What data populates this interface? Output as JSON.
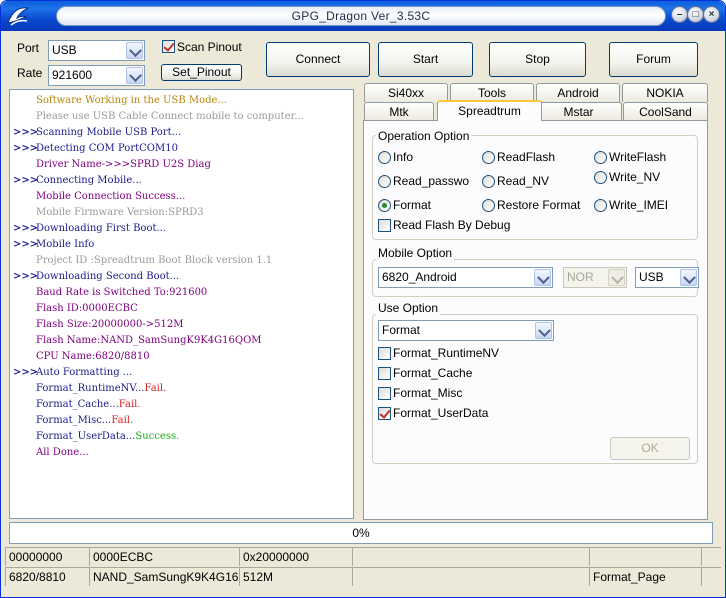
{
  "window": {
    "title": "GPG_Dragon  Ver_3.53C",
    "buttons": {
      "min": "–",
      "max": "□",
      "close": "×"
    }
  },
  "connection": {
    "port_label": "Port",
    "port_value": "USB",
    "rate_label": "Rate",
    "rate_value": "921600",
    "scan_pinout_label": "Scan Pinout",
    "scan_pinout_checked": true,
    "set_pinout_label": "Set_Pinout"
  },
  "toolbar": {
    "connect": "Connect",
    "start": "Start",
    "stop": "Stop",
    "forum": "Forum"
  },
  "tabs_row1": [
    "Si40xx",
    "Tools",
    "Android",
    "NOKIA"
  ],
  "tabs_row2": [
    "Mtk",
    "Spreadtrum",
    "Mstar",
    "CoolSand"
  ],
  "active_tab": "Spreadtrum",
  "log": [
    {
      "prefix": "",
      "text": "Software Working in the USB Mode...",
      "color": "#b8860b"
    },
    {
      "prefix": "",
      "text": "Please use USB Cable Connect mobile to computer...",
      "color": "#9a9a9a"
    },
    {
      "prefix": ">>>",
      "text": "Scanning Mobile USB Port...",
      "color": "#1d1a8a"
    },
    {
      "prefix": ">>>",
      "text": "Detecting COM PortCOM10",
      "color": "#1d1a8a"
    },
    {
      "prefix": "",
      "text": "Driver Name->>>SPRD U2S Diag",
      "color": "#800080"
    },
    {
      "prefix": ">>>",
      "text": "Connecting Mobile...",
      "color": "#1d1a8a"
    },
    {
      "prefix": "",
      "text": "Mobile Connection Success...",
      "color": "#800080"
    },
    {
      "prefix": "",
      "text": "Mobile Firmware Version:SPRD3",
      "color": "#9a9a9a"
    },
    {
      "prefix": ">>>",
      "text": "Downloading First Boot...",
      "color": "#1d1a8a"
    },
    {
      "prefix": ">>>",
      "text": "Mobile Info",
      "color": "#1d1a8a"
    },
    {
      "prefix": "",
      "text": "Project ID :Spreadtrum Boot Block version 1.1",
      "color": "#9a9a9a"
    },
    {
      "prefix": ">>>",
      "text": "Downloading Second Boot...",
      "color": "#1d1a8a"
    },
    {
      "prefix": "",
      "text": " Baud Rate is Switched To:921600",
      "color": "#800080"
    },
    {
      "prefix": "",
      "text": "Flash ID:0000ECBC",
      "color": "#800080"
    },
    {
      "prefix": "",
      "text": "Flash Size:20000000->512M",
      "color": "#800080"
    },
    {
      "prefix": "",
      "text": "Flash Name:NAND_SamSungK9K4G16QOM",
      "color": "#800080"
    },
    {
      "prefix": "",
      "text": "CPU Name:6820/8810",
      "color": "#800080"
    },
    {
      "prefix": ">>>",
      "text": "Auto Formatting ...",
      "color": "#1d1a8a"
    },
    {
      "prefix": "",
      "text": "Format_RuntimeNV...",
      "color": "#1d1a8a",
      "suffix": "Fail.",
      "suffix_color": "#d42020"
    },
    {
      "prefix": "",
      "text": "Format_Cache...",
      "color": "#1d1a8a",
      "suffix": "Fail.",
      "suffix_color": "#d42020"
    },
    {
      "prefix": "",
      "text": "Format_Misc...",
      "color": "#1d1a8a",
      "suffix": "Fail.",
      "suffix_color": "#d42020"
    },
    {
      "prefix": "",
      "text": "Format_UserData...",
      "color": "#1d1a8a",
      "suffix": "Success.",
      "suffix_color": "#1ea81e"
    },
    {
      "prefix": "",
      "text": "All Done...",
      "color": "#800080"
    }
  ],
  "operation": {
    "legend": "Operation Option",
    "options": [
      {
        "label": "Info",
        "selected": false
      },
      {
        "label": "ReadFlash",
        "selected": false
      },
      {
        "label": "WriteFlash",
        "selected": false
      },
      {
        "label": "Read_passwo",
        "selected": false
      },
      {
        "label": "Read_NV",
        "selected": false
      },
      {
        "label": "Write_NV",
        "selected": false
      },
      {
        "label": "Format",
        "selected": true
      },
      {
        "label": "Restore Format",
        "selected": false
      },
      {
        "label": "Write_IMEI",
        "selected": false
      }
    ],
    "read_flash_by_debug": {
      "label": "Read Flash By Debug",
      "checked": false
    }
  },
  "mobile": {
    "legend": "Mobile Option",
    "model": "6820_Android",
    "flash_type": "NOR",
    "interface": "USB"
  },
  "use": {
    "legend": "Use Option",
    "mode": "Format",
    "checks": [
      {
        "label": "Format_RuntimeNV",
        "checked": false
      },
      {
        "label": "Format_Cache",
        "checked": false
      },
      {
        "label": "Format_Misc",
        "checked": false
      },
      {
        "label": "Format_UserData",
        "checked": true
      }
    ],
    "ok_label": "OK"
  },
  "progress": {
    "text": "0%",
    "value": 0
  },
  "status_row1": [
    "00000000",
    "0000ECBC",
    "0x20000000",
    "",
    "",
    ""
  ],
  "status_row2": [
    "6820/8810",
    "NAND_SamSungK9K4G16Q(",
    "512M",
    "",
    "Format_Page",
    ""
  ]
}
